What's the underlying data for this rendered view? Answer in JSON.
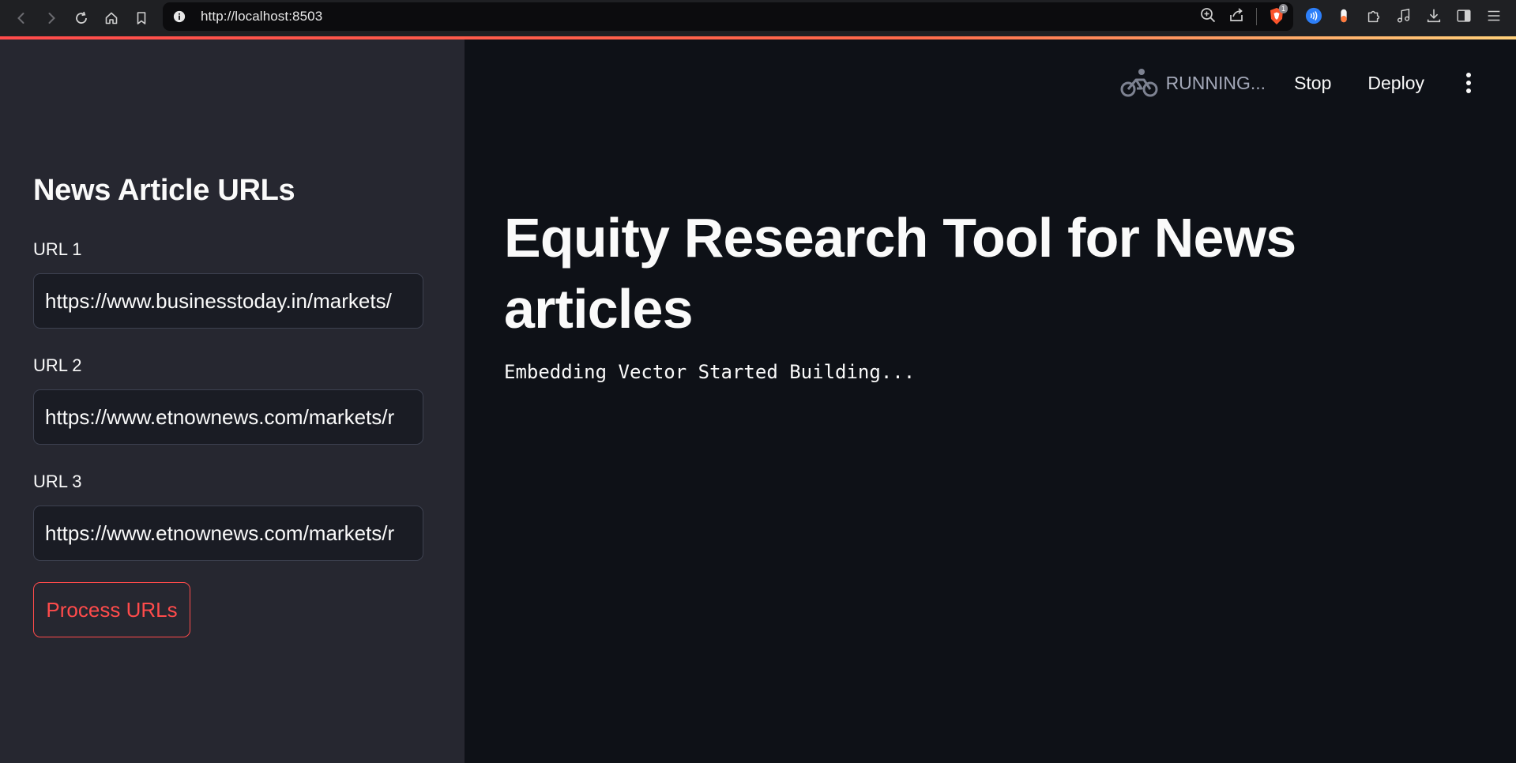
{
  "browser": {
    "url": "http://localhost:8503",
    "brave_badge": "1"
  },
  "sidebar": {
    "heading": "News Article URLs",
    "inputs": [
      {
        "label": "URL 1",
        "value": "https://www.businesstoday.in/markets/"
      },
      {
        "label": "URL 2",
        "value": "https://www.etnownews.com/markets/r"
      },
      {
        "label": "URL 3",
        "value": "https://www.etnownews.com/markets/r"
      }
    ],
    "button_label": "Process URLs"
  },
  "header": {
    "status": "RUNNING...",
    "stop_label": "Stop",
    "deploy_label": "Deploy"
  },
  "main": {
    "title": "Equity Research Tool for News articles",
    "status_message": "Embedding Vector Started Building..."
  },
  "colors": {
    "accent": "#ff4b4b",
    "sidebar_bg": "#262730",
    "main_bg": "#0e1117",
    "input_bg": "#1a1c24"
  }
}
